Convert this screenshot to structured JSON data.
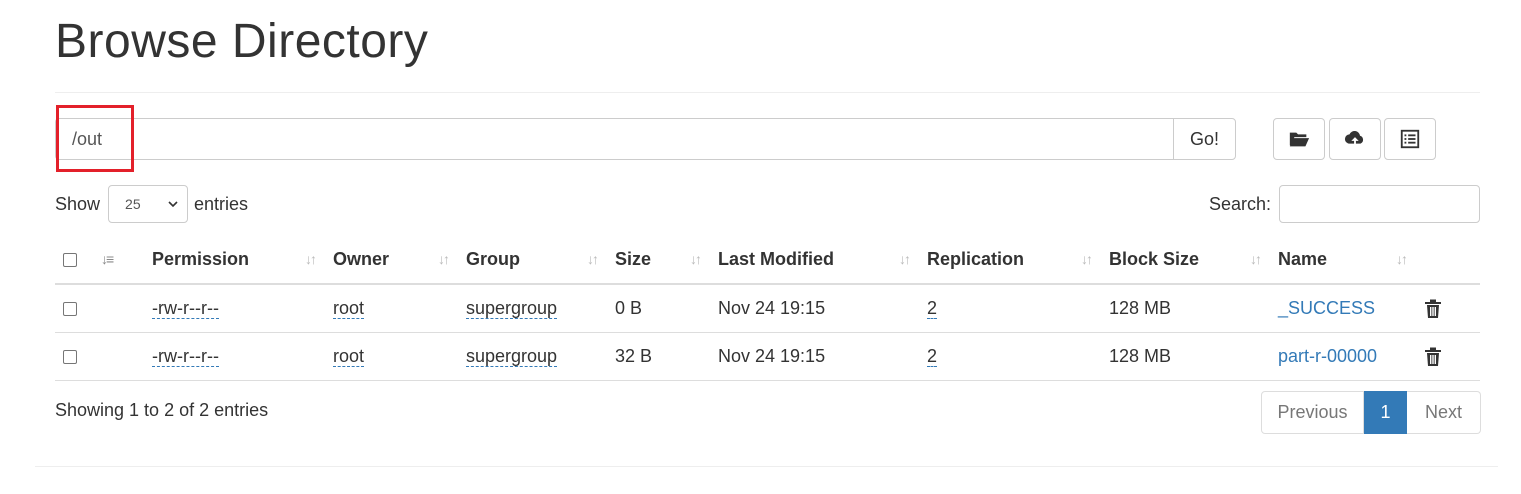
{
  "page": {
    "title": "Browse Directory"
  },
  "path_bar": {
    "value": "/out",
    "go_label": "Go!"
  },
  "toolbar": {
    "icons": [
      "folder-open-icon",
      "cloud-upload-icon",
      "list-alt-icon"
    ]
  },
  "length_menu": {
    "show_label": "Show",
    "value": "25",
    "entries_label": "entries"
  },
  "search": {
    "label": "Search:",
    "value": ""
  },
  "table": {
    "columns": [
      "Permission",
      "Owner",
      "Group",
      "Size",
      "Last Modified",
      "Replication",
      "Block Size",
      "Name"
    ],
    "rows": [
      {
        "permission": "-rw-r--r--",
        "owner": "root",
        "group": "supergroup",
        "size": "0 B",
        "modified": "Nov 24 19:15",
        "replication": "2",
        "block_size": "128 MB",
        "name": "_SUCCESS"
      },
      {
        "permission": "-rw-r--r--",
        "owner": "root",
        "group": "supergroup",
        "size": "32 B",
        "modified": "Nov 24 19:15",
        "replication": "2",
        "block_size": "128 MB",
        "name": "part-r-00000"
      }
    ]
  },
  "footer": {
    "info": "Showing 1 to 2 of 2 entries"
  },
  "pagination": {
    "previous": "Previous",
    "current": "1",
    "next": "Next"
  },
  "colors": {
    "accent": "#337ab7",
    "highlight": "#e3202a"
  }
}
